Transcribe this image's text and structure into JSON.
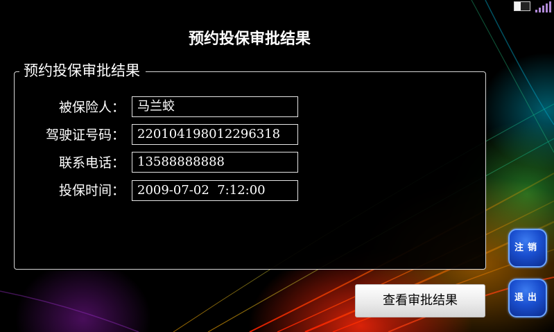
{
  "page": {
    "title": "预约投保审批结果"
  },
  "group": {
    "legend": "预约投保审批结果",
    "fields": [
      {
        "label": "被保险人：",
        "value": "马兰蛟"
      },
      {
        "label": "驾驶证号码：",
        "value": "220104198012296318"
      },
      {
        "label": "联系电话：",
        "value": "13588888888"
      },
      {
        "label": "投保时间：",
        "value": "2009-07-02  7:12:00"
      }
    ]
  },
  "buttons": {
    "check_result": "查看审批结果",
    "logout": "注销",
    "exit": "退出"
  },
  "status": {
    "battery_icon": "battery-icon",
    "signal_icon": "signal-strength-icon"
  },
  "colors": {
    "side_button": "#1a4fcf",
    "side_button_border": "#6ea6ff"
  }
}
